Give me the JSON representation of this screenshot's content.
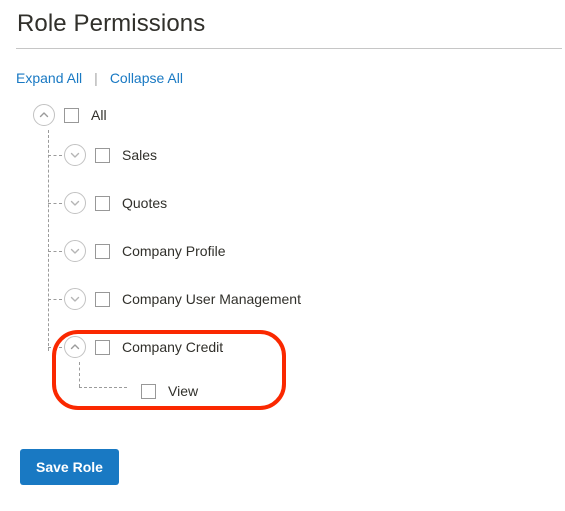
{
  "header": {
    "title": "Role Permissions"
  },
  "links": {
    "expand_all": "Expand All",
    "collapse_all": "Collapse All",
    "separator": "|"
  },
  "tree": {
    "nodes": [
      {
        "label": "All",
        "level": 0,
        "toggle": "chevron-up-icon",
        "expanded": true,
        "checked": false
      },
      {
        "label": "Sales",
        "level": 1,
        "toggle": "chevron-down-icon",
        "expanded": false,
        "checked": false
      },
      {
        "label": "Quotes",
        "level": 1,
        "toggle": "chevron-down-icon",
        "expanded": false,
        "checked": false
      },
      {
        "label": "Company Profile",
        "level": 1,
        "toggle": "chevron-down-icon",
        "expanded": false,
        "checked": false
      },
      {
        "label": "Company User Management",
        "level": 1,
        "toggle": "chevron-down-icon",
        "expanded": false,
        "checked": false
      },
      {
        "label": "Company Credit",
        "level": 1,
        "toggle": "chevron-up-icon",
        "expanded": true,
        "checked": false
      },
      {
        "label": "View",
        "level": 2,
        "toggle": "none",
        "expanded": false,
        "checked": false
      }
    ]
  },
  "annotation": {
    "color": "#fa2800",
    "target": "Company Credit"
  },
  "footer": {
    "save_label": "Save Role"
  },
  "colors": {
    "link": "#1979c3",
    "button": "#1979c3",
    "text": "#31302b",
    "border": "#c6c6c6",
    "highlight": "#fa2800"
  }
}
